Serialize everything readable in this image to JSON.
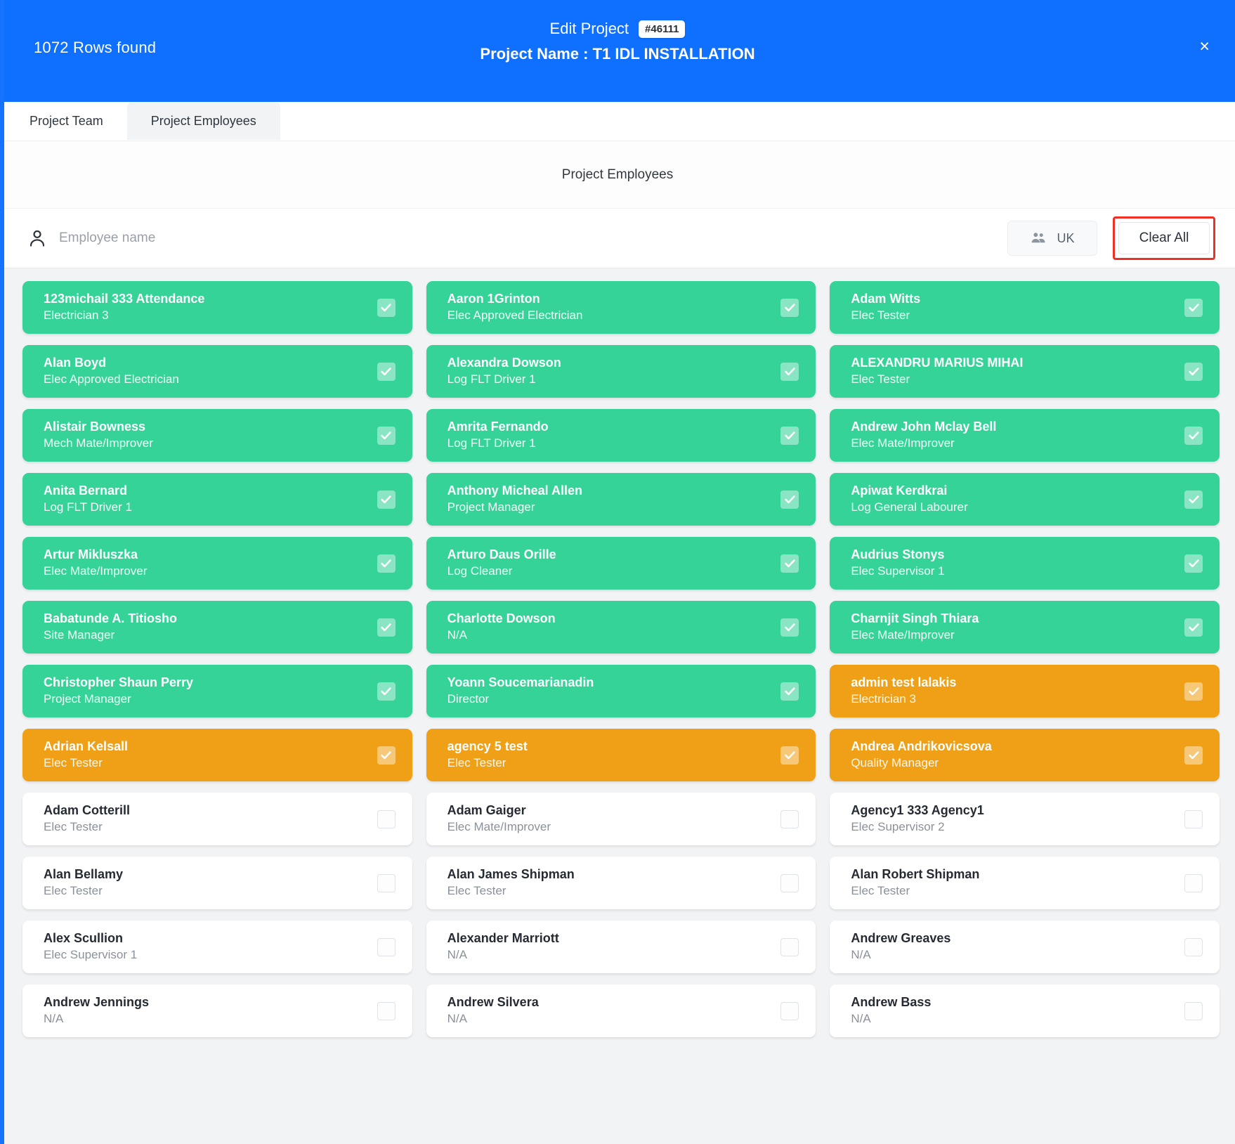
{
  "header": {
    "rows_found": "1072 Rows found",
    "edit_title": "Edit Project",
    "project_id_badge": "#46111",
    "project_name_line": "Project Name : T1 IDL INSTALLATION",
    "close_label": "×",
    "bg_color": "#0f6fff"
  },
  "tabs": [
    {
      "label": "Project Team",
      "active": false
    },
    {
      "label": "Project Employees",
      "active": true
    }
  ],
  "section": {
    "title": "Project Employees"
  },
  "search": {
    "placeholder": "Employee name",
    "value": "",
    "icon": "person-icon"
  },
  "toolbar": {
    "region_button": {
      "label": "UK",
      "icon": "people-group-icon"
    },
    "clear_all_button": {
      "label": "Clear All",
      "highlight_color": "#ee3124"
    }
  },
  "legend_colors": {
    "selected_green": "#35d398",
    "selected_orange": "#f0a017",
    "unselected_white": "#ffffff",
    "grid_background": "#f2f3f5"
  },
  "employees": [
    {
      "name": "123michail 333 Attendance",
      "role": "Electrician 3",
      "state": "green",
      "checked": true
    },
    {
      "name": "Aaron 1Grinton",
      "role": "Elec Approved Electrician",
      "state": "green",
      "checked": true
    },
    {
      "name": "Adam Witts",
      "role": "Elec Tester",
      "state": "green",
      "checked": true
    },
    {
      "name": "Alan Boyd",
      "role": "Elec Approved Electrician",
      "state": "green",
      "checked": true
    },
    {
      "name": "Alexandra Dowson",
      "role": "Log FLT Driver 1",
      "state": "green",
      "checked": true
    },
    {
      "name": "ALEXANDRU MARIUS MIHAI",
      "role": "Elec Tester",
      "state": "green",
      "checked": true
    },
    {
      "name": "Alistair Bowness",
      "role": "Mech Mate/Improver",
      "state": "green",
      "checked": true
    },
    {
      "name": "Amrita Fernando",
      "role": "Log FLT Driver 1",
      "state": "green",
      "checked": true
    },
    {
      "name": "Andrew John Mclay Bell",
      "role": "Elec Mate/Improver",
      "state": "green",
      "checked": true
    },
    {
      "name": "Anita Bernard",
      "role": "Log FLT Driver 1",
      "state": "green",
      "checked": true
    },
    {
      "name": "Anthony Micheal Allen",
      "role": "Project Manager",
      "state": "green",
      "checked": true
    },
    {
      "name": "Apiwat Kerdkrai",
      "role": "Log General Labourer",
      "state": "green",
      "checked": true
    },
    {
      "name": "Artur Mikluszka",
      "role": "Elec Mate/Improver",
      "state": "green",
      "checked": true
    },
    {
      "name": "Arturo Daus Orille",
      "role": "Log Cleaner",
      "state": "green",
      "checked": true
    },
    {
      "name": "Audrius Stonys",
      "role": "Elec Supervisor 1",
      "state": "green",
      "checked": true
    },
    {
      "name": "Babatunde A. Titiosho",
      "role": "Site Manager",
      "state": "green",
      "checked": true
    },
    {
      "name": "Charlotte Dowson",
      "role": "N/A",
      "state": "green",
      "checked": true
    },
    {
      "name": "Charnjit Singh Thiara",
      "role": "Elec Mate/Improver",
      "state": "green",
      "checked": true
    },
    {
      "name": "Christopher Shaun Perry",
      "role": "Project Manager",
      "state": "green",
      "checked": true
    },
    {
      "name": "Yoann Soucemarianadin",
      "role": "Director",
      "state": "green",
      "checked": true
    },
    {
      "name": "admin test lalakis",
      "role": "Electrician 3",
      "state": "orange",
      "checked": true
    },
    {
      "name": "Adrian Kelsall",
      "role": "Elec Tester",
      "state": "orange",
      "checked": true
    },
    {
      "name": "agency 5 test",
      "role": "Elec Tester",
      "state": "orange",
      "checked": true
    },
    {
      "name": "Andrea Andrikovicsova",
      "role": "Quality Manager",
      "state": "orange",
      "checked": true
    },
    {
      "name": "Adam Cotterill",
      "role": "Elec Tester",
      "state": "plain",
      "checked": false
    },
    {
      "name": "Adam Gaiger",
      "role": "Elec Mate/Improver",
      "state": "plain",
      "checked": false
    },
    {
      "name": "Agency1 333 Agency1",
      "role": "Elec Supervisor 2",
      "state": "plain",
      "checked": false
    },
    {
      "name": "Alan Bellamy",
      "role": "Elec Tester",
      "state": "plain",
      "checked": false
    },
    {
      "name": "Alan James Shipman",
      "role": "Elec Tester",
      "state": "plain",
      "checked": false
    },
    {
      "name": "Alan Robert Shipman",
      "role": "Elec Tester",
      "state": "plain",
      "checked": false
    },
    {
      "name": "Alex Scullion",
      "role": "Elec Supervisor 1",
      "state": "plain",
      "checked": false
    },
    {
      "name": "Alexander Marriott",
      "role": "N/A",
      "state": "plain",
      "checked": false
    },
    {
      "name": "Andrew Greaves",
      "role": "N/A",
      "state": "plain",
      "checked": false
    },
    {
      "name": "Andrew Jennings",
      "role": "N/A",
      "state": "plain",
      "checked": false
    },
    {
      "name": "Andrew Silvera",
      "role": "N/A",
      "state": "plain",
      "checked": false
    },
    {
      "name": "Andrew Bass",
      "role": "N/A",
      "state": "plain",
      "checked": false
    }
  ]
}
